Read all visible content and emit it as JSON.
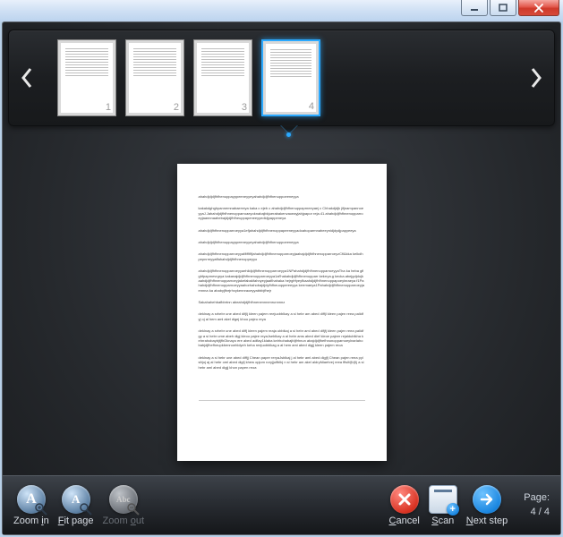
{
  "window": {
    "minimize": "minimize",
    "maximize": "maximize",
    "close": "close"
  },
  "thumbnails": {
    "items": [
      {
        "num": "1",
        "selected": false
      },
      {
        "num": "2",
        "selected": false
      },
      {
        "num": "3",
        "selected": false
      },
      {
        "num": "4",
        "selected": true
      }
    ]
  },
  "toolbar": {
    "zoom_in_letter": "A",
    "zoom_in_label_pre": "Zoom ",
    "zoom_in_label_u": "i",
    "zoom_in_label_post": "n",
    "fit_letter": "A",
    "fit_label_u": "F",
    "fit_label_post": "it page",
    "zoom_out_letter": "Abc",
    "zoom_out_label_pre": "Zoom ",
    "zoom_out_label_u": "o",
    "zoom_out_label_post": "ut",
    "cancel_label_u": "C",
    "cancel_label_post": "ancel",
    "scan_label_u": "S",
    "scan_label_post": "can",
    "next_label_u": "N",
    "next_label_post": "ext step"
  },
  "page_indicator": {
    "label": "Page:",
    "value": "4 / 4"
  },
  "colors": {
    "accent": "#2aa9ff",
    "danger": "#d93222",
    "primary": "#1a86e0"
  }
}
